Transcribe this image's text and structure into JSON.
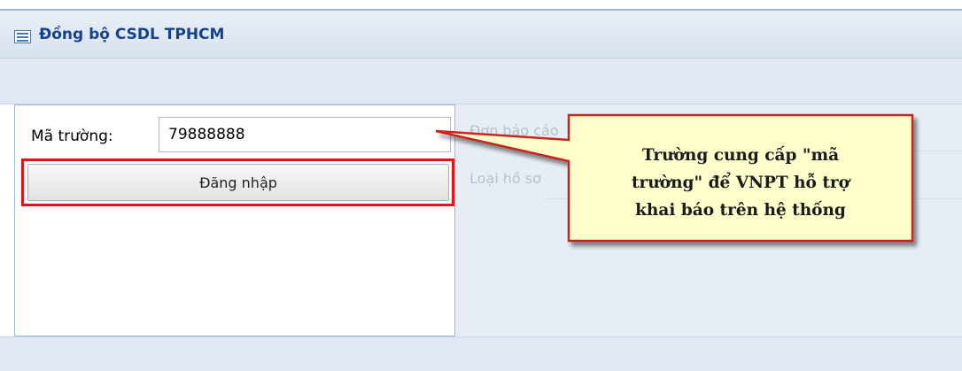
{
  "window": {
    "title": "Đồng bộ CSDL TPHCM",
    "title_icon": "form-icon"
  },
  "form": {
    "school_code_label": "Mã trường:",
    "school_code_value": "79888888",
    "login_button_label": "Đăng nhập"
  },
  "background_panel": {
    "label_1": "Đơn báo cáo",
    "label_2": "Loại hồ sơ"
  },
  "callout": {
    "text": "Trường cung cấp \"mã\ntrường\" để  VNPT hỗ trợ\nkhai báo trên hệ thống"
  },
  "colors": {
    "accent": "#15428b",
    "highlight": "#e0141e",
    "callout_fill": "#ffffcc",
    "callout_border": "#c8281e"
  }
}
